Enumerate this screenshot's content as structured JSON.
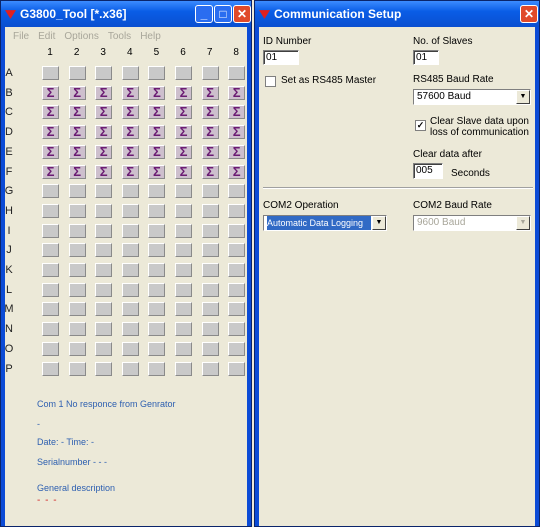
{
  "main_window": {
    "title": "G3800_Tool [*.x36]",
    "menu": [
      "File",
      "Edit",
      "Options",
      "Tools",
      "Help"
    ],
    "columns": [
      "1",
      "2",
      "3",
      "4",
      "5",
      "6",
      "7",
      "8"
    ],
    "rows": [
      "A",
      "B",
      "C",
      "D",
      "E",
      "F",
      "G",
      "H",
      "I",
      "J",
      "K",
      "L",
      "M",
      "N",
      "O",
      "P"
    ],
    "sigma_rows": [
      "B",
      "C",
      "D",
      "E",
      "F"
    ],
    "sigma_glyph": "Σ",
    "status_lines": {
      "com": "Com 1 No responce from Genrator",
      "dash": "-",
      "datetime": "Date: - Time: -",
      "serial": "Serialnumber - - -",
      "general": "General description",
      "red_dashes": "- - -"
    }
  },
  "dialog": {
    "title": "Communication Setup",
    "id_number_label": "ID Number",
    "id_number_value": "01",
    "slaves_label": "No. of Slaves",
    "slaves_value": "01",
    "rs485_master_label": "Set as RS485 Master",
    "rs485_baud_label": "RS485 Baud Rate",
    "rs485_baud_value": "57600 Baud",
    "clear_slave_label_1": "Clear Slave data upon",
    "clear_slave_label_2": "loss of communication",
    "clear_after_label": "Clear data after",
    "clear_after_value": "005",
    "seconds_label": "Seconds",
    "com2_op_label": "COM2 Operation",
    "com2_op_value": "Automatic Data Logging",
    "com2_baud_label": "COM2 Baud Rate",
    "com2_baud_value": "9600 Baud"
  },
  "colors": {
    "titlebar": "#0a5de6",
    "sigma": "#6b1b73",
    "status": "#2d5fb0",
    "close": "#e04a2a"
  }
}
